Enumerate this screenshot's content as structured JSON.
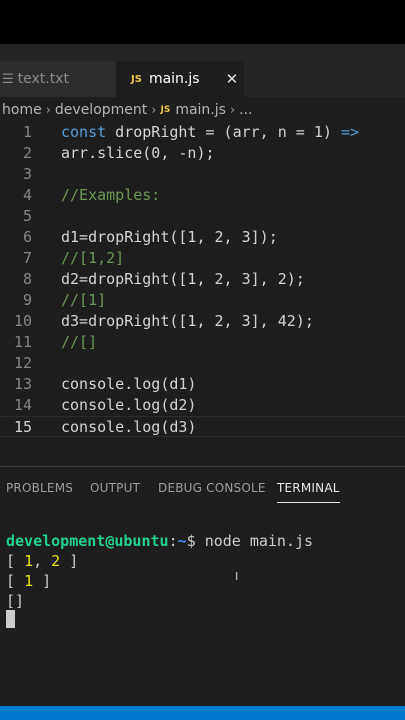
{
  "tabs": [
    {
      "label": "text.txt",
      "icon": "text-file-icon",
      "active": false
    },
    {
      "label": "main.js",
      "icon": "js-file-icon",
      "active": true,
      "close": "✕",
      "icon_text": "JS"
    }
  ],
  "breadcrumb": {
    "items": [
      "home",
      "development"
    ],
    "file": "main.js",
    "file_icon_text": "JS",
    "ellipsis": "..."
  },
  "editor": {
    "current_line": 15,
    "lines": [
      {
        "n": "1",
        "text": "const dropRight = (arr, n = 1) =>"
      },
      {
        "n": "2",
        "text": "arr.slice(0, -n);"
      },
      {
        "n": "3",
        "text": ""
      },
      {
        "n": "4",
        "text": "//Examples:"
      },
      {
        "n": "5",
        "text": ""
      },
      {
        "n": "6",
        "text": "d1=dropRight([1, 2, 3]);"
      },
      {
        "n": "7",
        "text": "//[1,2]"
      },
      {
        "n": "8",
        "text": "d2=dropRight([1, 2, 3], 2);"
      },
      {
        "n": "9",
        "text": "//[1]"
      },
      {
        "n": "10",
        "text": "d3=dropRight([1, 2, 3], 42);"
      },
      {
        "n": "11",
        "text": "//[]"
      },
      {
        "n": "12",
        "text": ""
      },
      {
        "n": "13",
        "text": "console.log(d1)"
      },
      {
        "n": "14",
        "text": "console.log(d2)"
      },
      {
        "n": "15",
        "text": "console.log(d3)"
      }
    ]
  },
  "panel": {
    "tabs": [
      "PROBLEMS",
      "OUTPUT",
      "DEBUG CONSOLE",
      "TERMINAL"
    ],
    "active_tab": "TERMINAL"
  },
  "terminal": {
    "user": "development@ubuntu",
    "path_sep": ":",
    "path": "~",
    "prompt_end": "$ ",
    "command": "node main.js",
    "output": [
      "[ 1, 2 ]",
      "[ 1 ]",
      "[]"
    ]
  },
  "colors": {
    "editor_bg": "#1e1e1e",
    "keyword": "#569cd6",
    "comment": "#6a9955",
    "status_bar": "#007acc",
    "terminal_user": "#23d18b",
    "terminal_number": "#e5e510"
  }
}
